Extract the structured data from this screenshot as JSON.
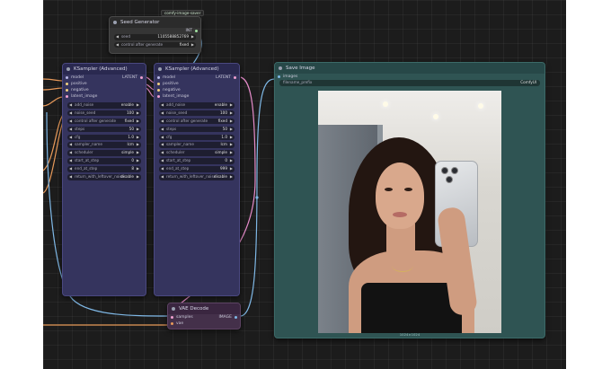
{
  "badge_text": "comfy-image-saver",
  "seed_node": {
    "title": "Seed Generator",
    "output": "INT",
    "widgets": [
      {
        "name": "seed",
        "value": "1105588852769"
      },
      {
        "name": "control after generate",
        "value": "fixed"
      }
    ]
  },
  "ksampler_left": {
    "title": "KSampler (Advanced)",
    "inputs": [
      "model",
      "positive",
      "negative",
      "latent_image"
    ],
    "output": "LATENT",
    "widgets": [
      {
        "name": "add_noise",
        "value": "enable"
      },
      {
        "name": "noise_seed",
        "value": "100"
      },
      {
        "name": "control after generate",
        "value": "fixed"
      },
      {
        "name": "steps",
        "value": "50"
      },
      {
        "name": "cfg",
        "value": "1.0"
      },
      {
        "name": "sampler_name",
        "value": "lcm"
      },
      {
        "name": "scheduler",
        "value": "simple"
      },
      {
        "name": "start_at_step",
        "value": "0"
      },
      {
        "name": "end_at_step",
        "value": "8"
      },
      {
        "name": "return_with_leftover_noise",
        "value": "disable"
      }
    ]
  },
  "ksampler_right": {
    "title": "KSampler (Advanced)",
    "inputs": [
      "model",
      "positive",
      "negative",
      "latent_image"
    ],
    "output": "LATENT",
    "widgets": [
      {
        "name": "add_noise",
        "value": "enable"
      },
      {
        "name": "noise_seed",
        "value": "100"
      },
      {
        "name": "control after generate",
        "value": "fixed"
      },
      {
        "name": "steps",
        "value": "50"
      },
      {
        "name": "cfg",
        "value": "1.0"
      },
      {
        "name": "sampler_name",
        "value": "lcm"
      },
      {
        "name": "scheduler",
        "value": "simple"
      },
      {
        "name": "start_at_step",
        "value": "0"
      },
      {
        "name": "end_at_step",
        "value": "999"
      },
      {
        "name": "return_with_leftover_noise",
        "value": "disable"
      }
    ]
  },
  "vae_node": {
    "title": "VAE Decode",
    "inputs": [
      "samples",
      "vae"
    ],
    "output": "IMAGE"
  },
  "save_node": {
    "title": "Save Image",
    "input": "images",
    "widget": {
      "name": "filename_prefix",
      "value": "ComfyUI"
    },
    "footer": "1024×1024"
  },
  "colors": {
    "canvas": "#1c1c1c",
    "ksampler": "#35345e",
    "save_image": "#2f5453",
    "vae": "#44304a",
    "wire_blue": "#7fb8e6",
    "wire_orange": "#e89a5a",
    "wire_pink": "#e58bc9"
  }
}
